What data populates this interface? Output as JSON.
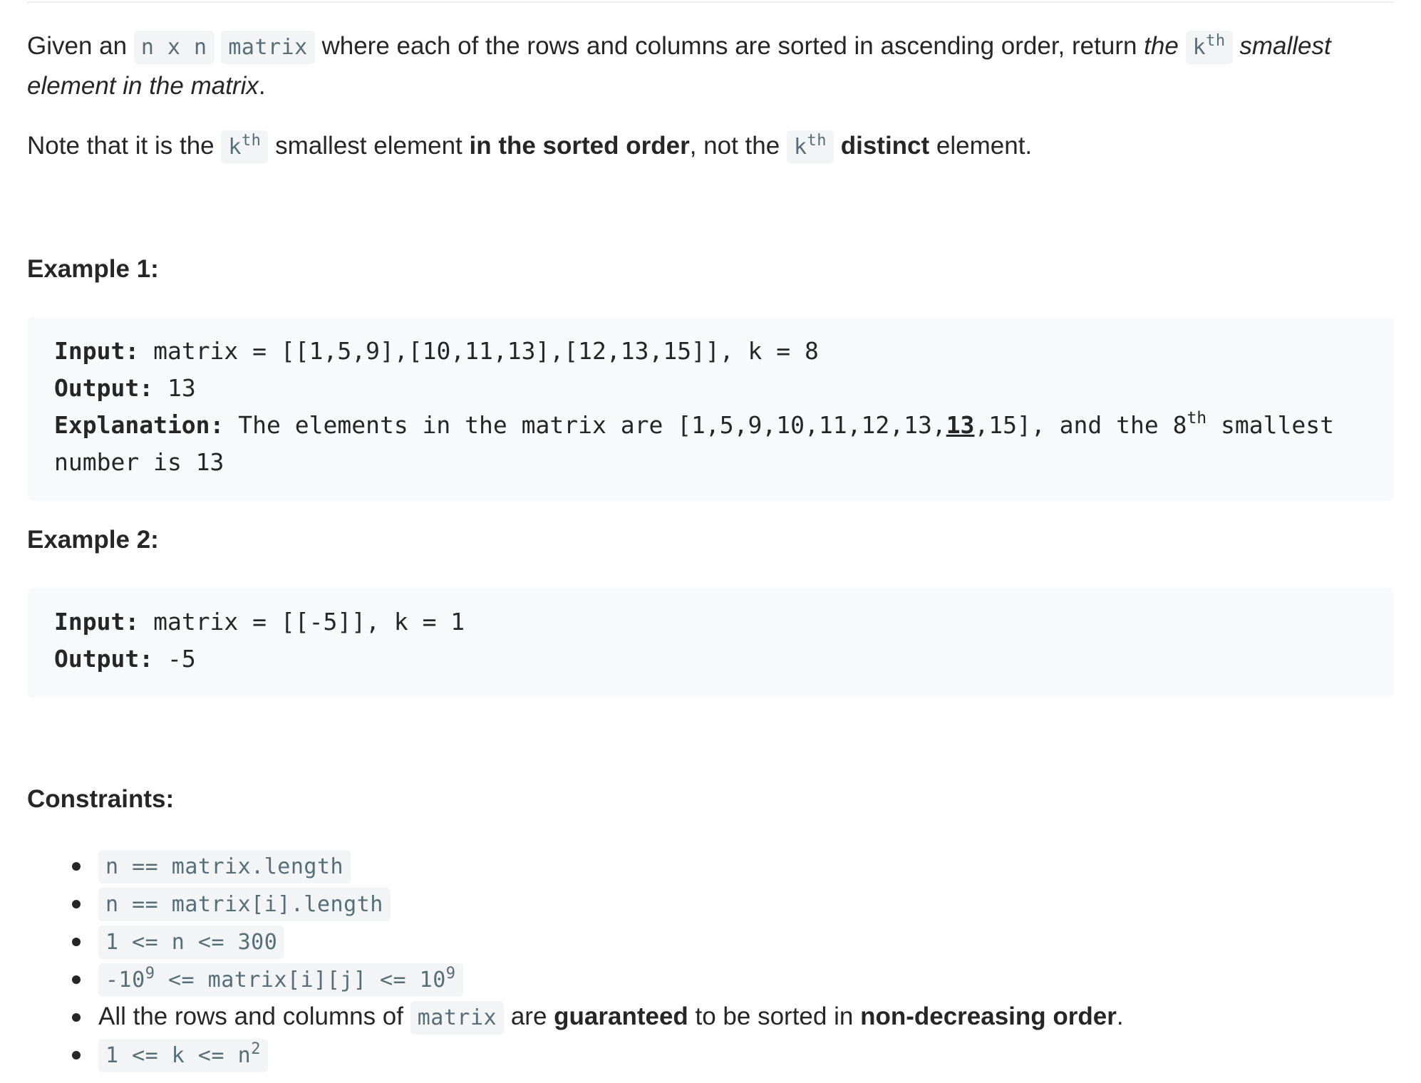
{
  "intro": {
    "p1_a": "Given an ",
    "p1_code_nxn": "n x n",
    "p1_code_matrix": "matrix",
    "p1_b": " where each of the rows and columns are sorted in ascending order, return ",
    "p1_em_the": "the ",
    "p1_code_k": "k",
    "p1_code_k_sup": "th",
    "p1_em_smallest": " smallest element in the matrix",
    "p1_end": ".",
    "p2_a": "Note that it is the ",
    "p2_code_k": "k",
    "p2_code_k_sup": "th",
    "p2_b": " smallest element ",
    "p2_strong_sorted": "in the sorted order",
    "p2_c": ", not the ",
    "p2_code_k2": "k",
    "p2_code_k2_sup": "th",
    "p2_space": " ",
    "p2_strong_distinct": "distinct",
    "p2_d": " element."
  },
  "examples": [
    {
      "heading": "Example 1:",
      "input_label": "Input:",
      "input_value": " matrix = [[1,5,9],[10,11,13],[12,13,15]], k = 8",
      "output_label": "Output:",
      "output_value": " 13",
      "explanation_label": "Explanation:",
      "explanation_a": " The elements in the matrix are [1,5,9,10,11,12,13,",
      "explanation_underlined": "13",
      "explanation_b": ",15], and the 8",
      "explanation_sup": "th",
      "explanation_c": " smallest number is 13"
    },
    {
      "heading": "Example 2:",
      "input_label": "Input:",
      "input_value": " matrix = [[-5]], k = 1",
      "output_label": "Output:",
      "output_value": " -5"
    }
  ],
  "constraints": {
    "heading": "Constraints:",
    "c1": "n == matrix.length",
    "c2": "n == matrix[i].length",
    "c3": "1 <= n <= 300",
    "c4_a": "-10",
    "c4_sup1": "9",
    "c4_b": " <= matrix[i][j] <= 10",
    "c4_sup2": "9",
    "c5_a": "All the rows and columns of ",
    "c5_code": "matrix",
    "c5_b": " are ",
    "c5_strong1": "guaranteed",
    "c5_c": " to be sorted in ",
    "c5_strong2": "non-decreasing order",
    "c5_d": ".",
    "c6_a": "1 <= k <= n",
    "c6_sup": "2"
  }
}
